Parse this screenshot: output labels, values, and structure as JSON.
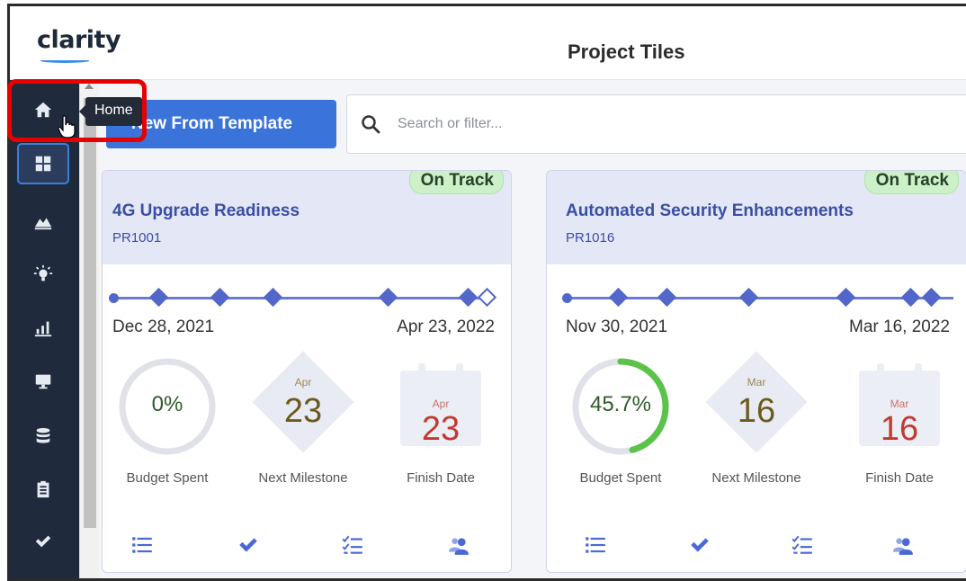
{
  "app": {
    "logo": "clarity",
    "page_title": "Project Tiles"
  },
  "sidebar": {
    "items": [
      {
        "name": "home",
        "icon": "home-icon"
      },
      {
        "name": "tiles",
        "icon": "grid-icon"
      },
      {
        "name": "roadmaps",
        "icon": "mountain-chart-icon"
      },
      {
        "name": "ideas",
        "icon": "lightbulb-icon"
      },
      {
        "name": "reports",
        "icon": "bar-chart-icon"
      },
      {
        "name": "monitor",
        "icon": "monitor-icon"
      },
      {
        "name": "data",
        "icon": "database-icon"
      },
      {
        "name": "timesheets",
        "icon": "clipboard-icon"
      },
      {
        "name": "approvals",
        "icon": "check-icon"
      }
    ]
  },
  "tooltip": {
    "label": "Home"
  },
  "toolbar": {
    "new_button_label": "New From Template"
  },
  "search": {
    "placeholder": "Search or filter..."
  },
  "tiles": [
    {
      "title": "4G Upgrade Readiness",
      "id": "PR1001",
      "status": "On Track",
      "start_date": "Dec 28, 2021",
      "end_date": "Apr 23, 2022",
      "budget_spent": "0%",
      "budget_fraction": 0,
      "budget_label": "Budget Spent",
      "milestone_month": "Apr",
      "milestone_day": "23",
      "milestone_label": "Next Milestone",
      "finish_month": "Apr",
      "finish_day": "23",
      "finish_label": "Finish Date"
    },
    {
      "title": "Automated Security Enhancements",
      "id": "PR1016",
      "status": "On Track",
      "start_date": "Nov 30, 2021",
      "end_date": "Mar 16, 2022",
      "budget_spent": "45.7%",
      "budget_fraction": 0.457,
      "budget_label": "Budget Spent",
      "milestone_month": "Mar",
      "milestone_day": "16",
      "milestone_label": "Next Milestone",
      "finish_month": "Mar",
      "finish_day": "16",
      "finish_label": "Finish Date"
    }
  ],
  "colors": {
    "accent": "#3a73d9",
    "sidebar": "#1f2a3d",
    "status_on_track": "#ccf0c8",
    "budget_ring": "#5bc24a",
    "highlight": "#e60000"
  }
}
